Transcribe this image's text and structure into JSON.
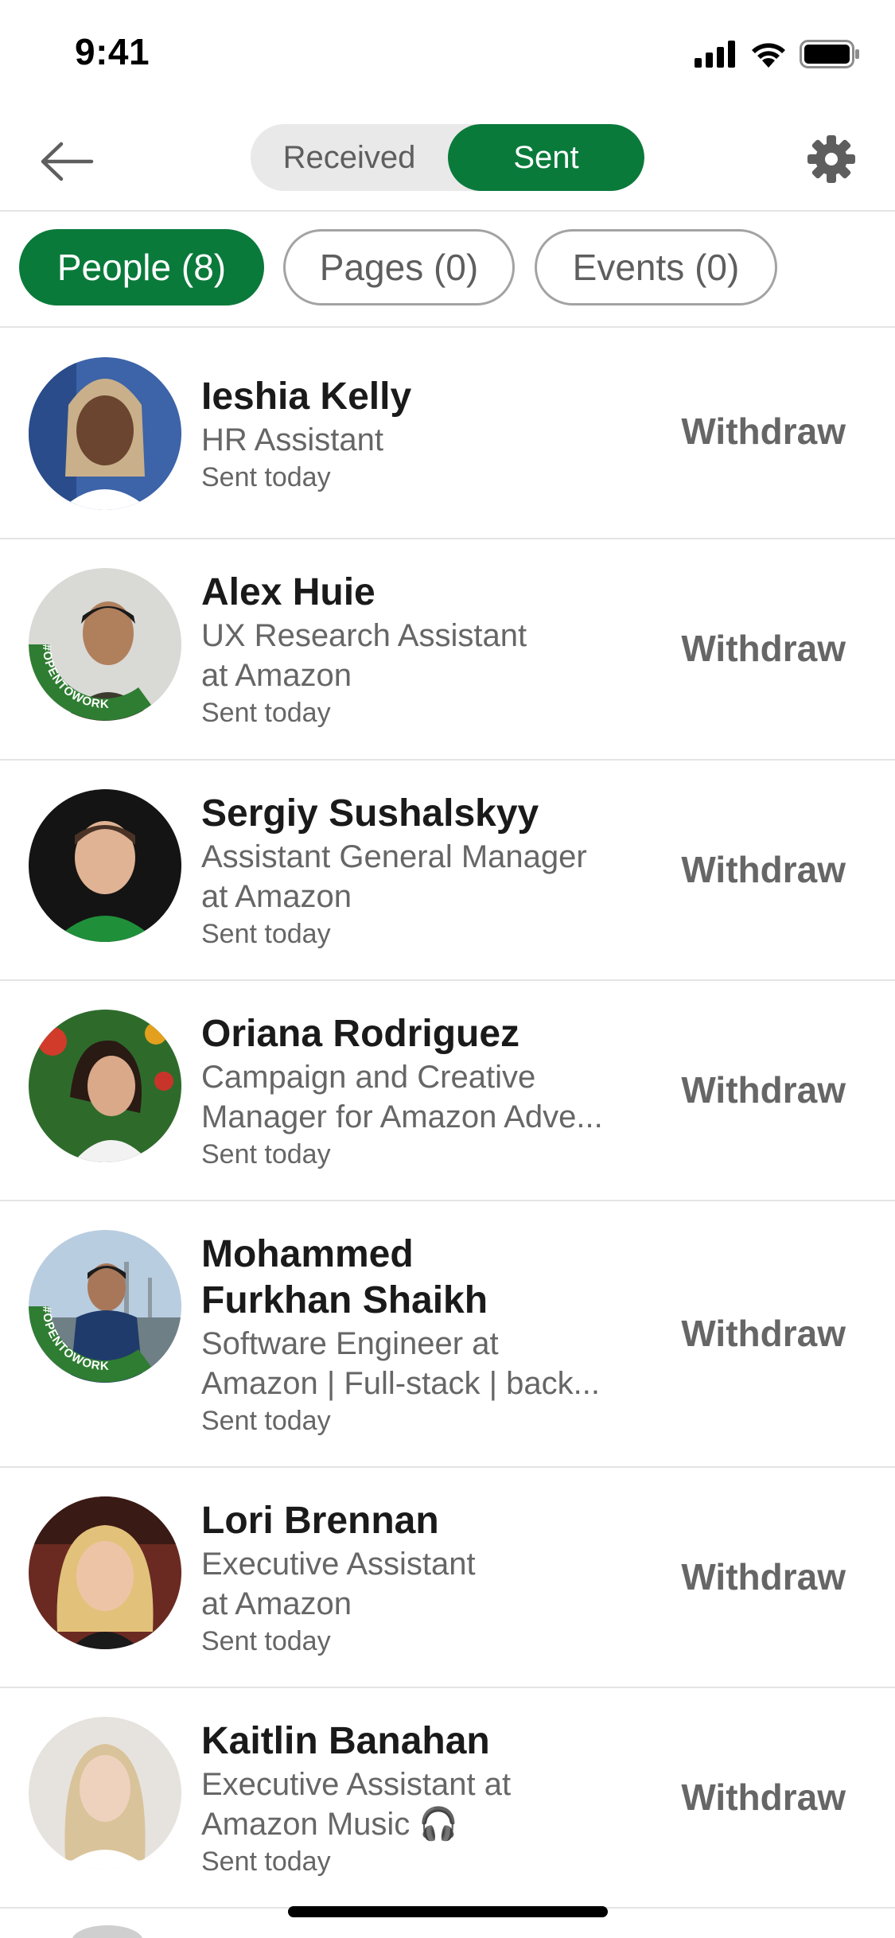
{
  "status_bar": {
    "time": "9:41"
  },
  "nav": {
    "tabs": [
      {
        "label": "Received"
      },
      {
        "label": "Sent"
      }
    ],
    "active_tab": "Sent"
  },
  "filters": [
    {
      "label": "People (8)",
      "active": true
    },
    {
      "label": "Pages (0)",
      "active": false
    },
    {
      "label": "Events (0)",
      "active": false
    }
  ],
  "invitations": [
    {
      "name": "Ieshia Kelly",
      "headline": [
        "HR Assistant"
      ],
      "sent": "Sent today",
      "action": "Withdraw",
      "open_to_work": false
    },
    {
      "name": "Alex Huie",
      "headline": [
        "UX Research Assistant",
        "at Amazon"
      ],
      "sent": "Sent today",
      "action": "Withdraw",
      "open_to_work": true
    },
    {
      "name": "Sergiy Sushalskyy",
      "headline": [
        "Assistant General Manager",
        "at Amazon"
      ],
      "sent": "Sent today",
      "action": "Withdraw",
      "open_to_work": false
    },
    {
      "name": "Oriana Rodriguez",
      "headline": [
        "Campaign and Creative",
        "Manager for Amazon Adve..."
      ],
      "sent": "Sent today",
      "action": "Withdraw",
      "open_to_work": false
    },
    {
      "name_lines": [
        "Mohammed",
        "Furkhan Shaikh"
      ],
      "headline": [
        "Software Engineer at",
        "Amazon | Full-stack | back..."
      ],
      "sent": "Sent today",
      "action": "Withdraw",
      "open_to_work": true
    },
    {
      "name": "Lori Brennan",
      "headline": [
        "Executive Assistant",
        "at Amazon"
      ],
      "sent": "Sent today",
      "action": "Withdraw",
      "open_to_work": false
    },
    {
      "name": "Kaitlin Banahan",
      "headline": [
        "Executive Assistant at",
        "Amazon Music 🎧"
      ],
      "sent": "Sent today",
      "action": "Withdraw",
      "open_to_work": false
    }
  ],
  "open_to_work_label": "#OPENTOWORK",
  "colors": {
    "accent": "#0a7a3b",
    "muted_text": "#666666",
    "divider": "#e4e4e4"
  }
}
